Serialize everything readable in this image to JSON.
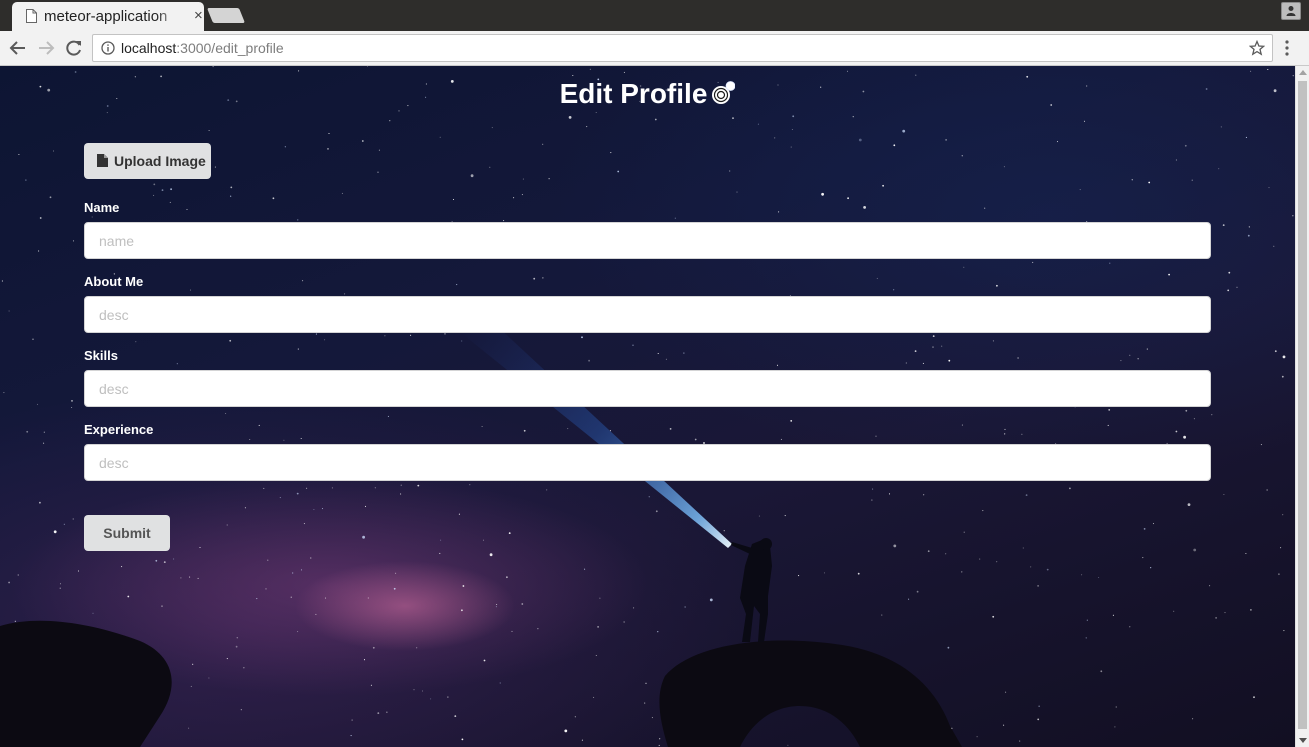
{
  "browser": {
    "tab_title": "meteor-application",
    "tab_close_glyph": "×",
    "url_host": "localhost",
    "url_path": ":3000/edit_profile",
    "icons": [
      "file-icon",
      "close-icon",
      "back-arrow-icon",
      "forward-arrow-icon",
      "reload-icon",
      "info-icon",
      "star-icon",
      "menu-icon",
      "profile-icon"
    ]
  },
  "page": {
    "title": "Edit Profile",
    "upload_button_label": "Upload Image",
    "fields": [
      {
        "label": "Name",
        "placeholder": "name",
        "value": ""
      },
      {
        "label": "About Me",
        "placeholder": "desc",
        "value": ""
      },
      {
        "label": "Skills",
        "placeholder": "desc",
        "value": ""
      },
      {
        "label": "Experience",
        "placeholder": "desc",
        "value": ""
      }
    ],
    "submit_label": "Submit"
  },
  "colors": {
    "button_bg": "#e0e1e2",
    "label_text": "#ffffff",
    "input_bg": "#ffffff",
    "placeholder": "#bfbfbf"
  }
}
